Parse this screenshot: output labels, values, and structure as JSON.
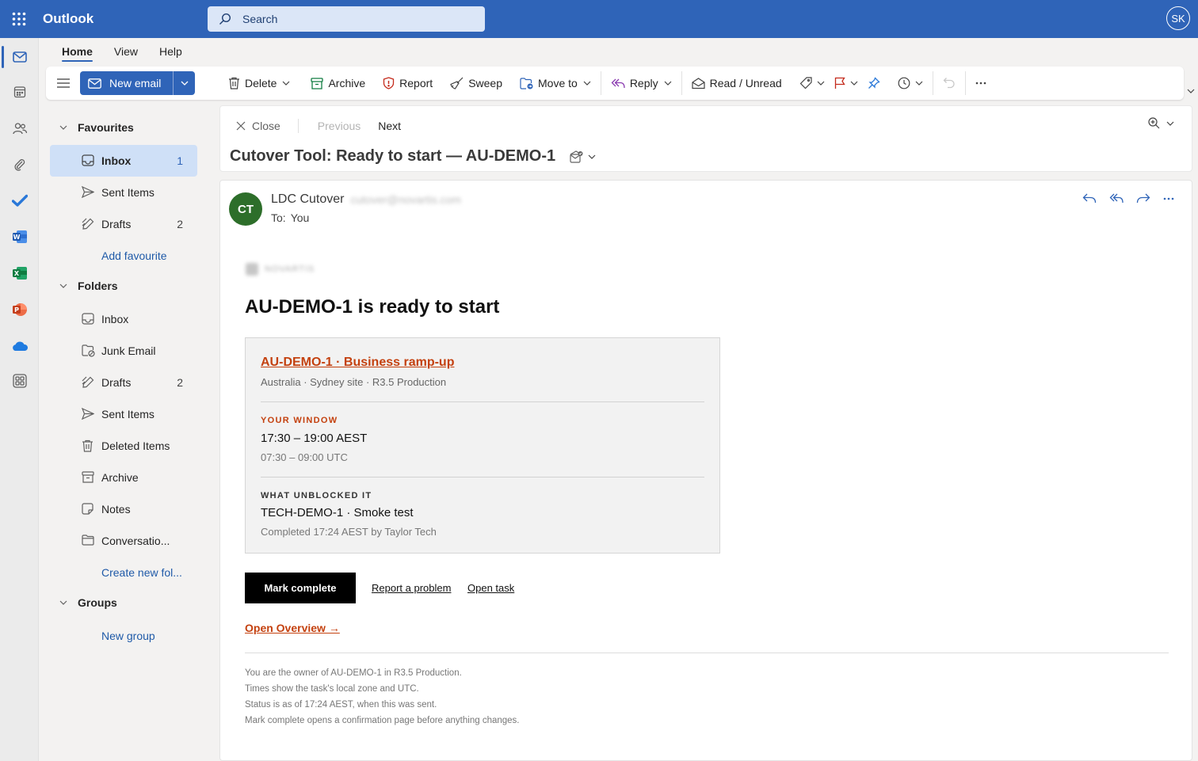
{
  "app": {
    "name": "Outlook",
    "user_initials": "SK"
  },
  "search": {
    "placeholder": "Search"
  },
  "tabs": [
    {
      "label": "Home",
      "active": true
    },
    {
      "label": "View",
      "active": false
    },
    {
      "label": "Help",
      "active": false
    }
  ],
  "ribbon": {
    "new_email": "New email",
    "delete": "Delete",
    "archive": "Archive",
    "report": "Report",
    "sweep": "Sweep",
    "move_to": "Move to",
    "reply": "Reply",
    "read_unread": "Read / Unread"
  },
  "folders": {
    "favourites_label": "Favourites",
    "favourites": [
      {
        "label": "Inbox",
        "count": "1",
        "icon": "inbox-icon",
        "selected": true
      },
      {
        "label": "Sent Items",
        "count": "",
        "icon": "send-icon"
      },
      {
        "label": "Drafts",
        "count": "2",
        "icon": "draft-icon"
      }
    ],
    "add_favourite": "Add favourite",
    "folders_label": "Folders",
    "items": [
      {
        "label": "Inbox",
        "count": "",
        "icon": "inbox-icon"
      },
      {
        "label": "Junk Email",
        "count": "",
        "icon": "junk-icon"
      },
      {
        "label": "Drafts",
        "count": "2",
        "icon": "draft-icon"
      },
      {
        "label": "Sent Items",
        "count": "",
        "icon": "send-icon"
      },
      {
        "label": "Deleted Items",
        "count": "",
        "icon": "trash-icon"
      },
      {
        "label": "Archive",
        "count": "",
        "icon": "archive-icon"
      },
      {
        "label": "Notes",
        "count": "",
        "icon": "notes-icon"
      },
      {
        "label": "Conversatio...",
        "count": "",
        "icon": "folder-icon"
      }
    ],
    "create_new_folder": "Create new fol...",
    "groups_label": "Groups",
    "new_group": "New group"
  },
  "reading": {
    "close": "Close",
    "previous": "Previous",
    "next": "Next",
    "subject": "Cutover Tool: Ready to start — AU-DEMO-1"
  },
  "message": {
    "avatar_initials": "CT",
    "sender_name": "LDC Cutover",
    "sender_email": "cutover@novartis.com",
    "to_label": "To:",
    "to_value": "You",
    "brand_text": "NOVARTIS",
    "heading": "AU-DEMO-1 is ready to start",
    "card": {
      "title": "AU-DEMO-1 · Business ramp-up",
      "subtitle": "Australia · Sydney site · R3.5 Production",
      "window_label": "YOUR WINDOW",
      "window_local": "17:30 – 19:00 AEST",
      "window_utc": "07:30 – 09:00 UTC",
      "unblocked_label": "WHAT UNBLOCKED IT",
      "unblocked_task": "TECH-DEMO-1 · Smoke test",
      "unblocked_detail": "Completed 17:24 AEST by Taylor Tech"
    },
    "mark_complete": "Mark complete",
    "report_problem": "Report a problem",
    "open_task": "Open task",
    "open_overview": "Open Overview →",
    "footer": [
      "You are the owner of AU-DEMO-1 in R3.5 Production.",
      "Times show the task's local zone and UTC.",
      "Status is as of 17:24 AEST, when this was sent.",
      "Mark complete opens a confirmation page before anything changes."
    ]
  },
  "colors": {
    "brand_blue": "#2f64b8",
    "accent_orange": "#c4410f",
    "avatar_green": "#2d6e2a",
    "selected_bg": "#cfe0f7"
  }
}
